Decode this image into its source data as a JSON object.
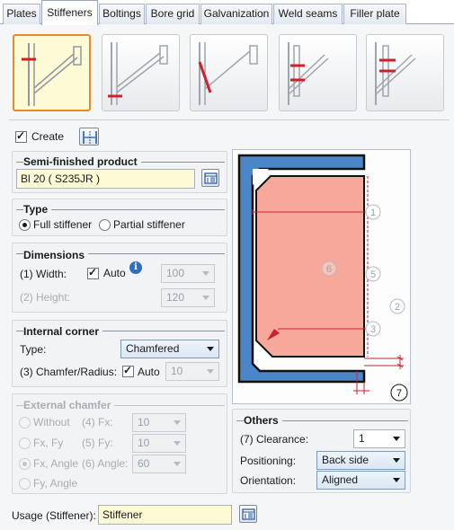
{
  "tabs": [
    "Plates",
    "Stiffeners",
    "Boltings",
    "Bore grid",
    "Galvanization",
    "Weld seams",
    "Filler plate"
  ],
  "active_tab": "Stiffeners",
  "create": {
    "label": "Create",
    "checked": true
  },
  "semi_finished": {
    "title": "Semi-finished product",
    "value": "Bl 20  ( S235JR )"
  },
  "type": {
    "title": "Type",
    "full_label": "Full stiffener",
    "partial_label": "Partial stiffener",
    "selected": "full"
  },
  "dimensions": {
    "title": "Dimensions",
    "width_label": "(1) Width:",
    "auto_label": "Auto",
    "auto_checked": true,
    "width_value": "100",
    "height_label": "(2) Height:",
    "height_value": "120"
  },
  "internal_corner": {
    "title": "Internal corner",
    "type_label": "Type:",
    "type_value": "Chamfered",
    "chamfer_label": "(3) Chamfer/Radius:",
    "auto_label": "Auto",
    "auto_checked": true,
    "chamfer_value": "10"
  },
  "external_chamfer": {
    "title": "External chamfer",
    "options": [
      "Without",
      "Fx, Fy",
      "Fx, Angle",
      "Fy, Angle"
    ],
    "selected": "Fx, Angle",
    "fx_label": "(4) Fx:",
    "fx_value": "10",
    "fy_label": "(5) Fy:",
    "fy_value": "10",
    "angle_label": "(6) Angle:",
    "angle_value": "60"
  },
  "others": {
    "title": "Others",
    "clearance_label": "(7) Clearance:",
    "clearance_value": "1",
    "positioning_label": "Positioning:",
    "positioning_value": "Back side",
    "orientation_label": "Orientation:",
    "orientation_value": "Aligned"
  },
  "preview_markers": [
    "1",
    "2",
    "3",
    "5",
    "6",
    "7"
  ],
  "usage": {
    "label": "Usage (Stiffener):",
    "value": "Stiffener"
  },
  "colors": {
    "accent_orange": "#e8892b",
    "profile_blue": "#4a86c8",
    "plate_salmon": "#f6a89a",
    "dim_red": "#d0202a",
    "field_yellow": "#fdfbd6"
  }
}
